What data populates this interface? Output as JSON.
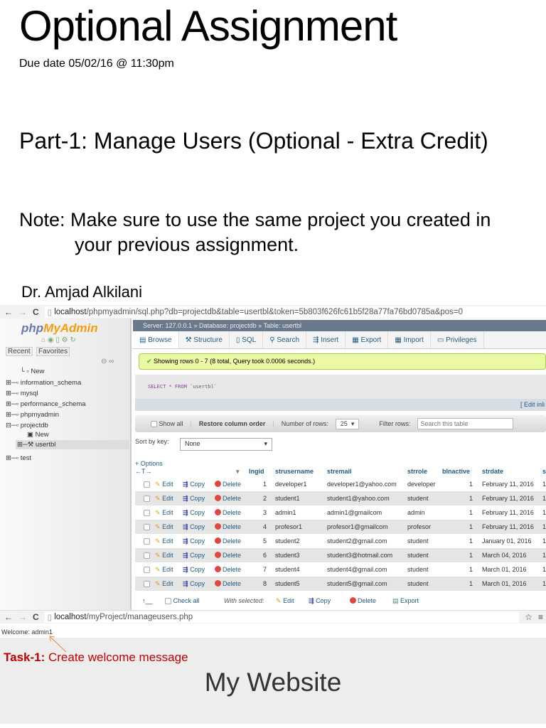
{
  "slide": {
    "title": "Optional Assignment",
    "due": "Due date 05/02/16 @ 11:30pm",
    "part": "Part-1: Manage Users (Optional - Extra Credit)",
    "note_label": "Note:",
    "note_line1": " Make sure to use the same project you created in",
    "note_line2": "your previous assignment.",
    "author": "Dr. Amjad Alkilani"
  },
  "browser1": {
    "url_host": "localhost",
    "url_rest": "/phpmyadmin/sql.php?db=projectdb&table=usertbl&token=5b803f626fc61b5f28a77fa76bd0785a&pos=0"
  },
  "pma": {
    "logo_a": "php",
    "logo_b": "MyAdmin",
    "recent": "Recent",
    "favorites": "Favorites",
    "tree": [
      "New",
      "information_schema",
      "mysql",
      "performance_schema",
      "phpmyadmin",
      "projectdb",
      "New",
      "usertbl",
      "test"
    ],
    "breadcrumb": "Server: 127.0.0.1 » Database: projectdb » Table: usertbl",
    "tabs": [
      "Browse",
      "Structure",
      "SQL",
      "Search",
      "Insert",
      "Export",
      "Import",
      "Privileges"
    ],
    "success": "Showing rows 0 - 7 (8 total, Query took 0.0006 seconds.)",
    "sql_kw": "SELECT * FROM",
    "sql_tbl": " `usertbl`",
    "edit_inline": "[ Edit inli",
    "show_all": "Show all",
    "restore": "Restore column order",
    "num_rows_label": "Number of rows:",
    "num_rows": "25",
    "filter_label": "Filter rows:",
    "filter_placeholder": "Search this table",
    "sort_label": "Sort by key:",
    "sort_value": "None",
    "options": "+ Options",
    "columns": [
      "lngid",
      "strusername",
      "stremail",
      "strrole",
      "blnactive",
      "strdate",
      "s"
    ],
    "actions": {
      "edit": "Edit",
      "copy": "Copy",
      "delete": "Delete"
    },
    "rows": [
      [
        "1",
        "developer1",
        "developer1@yahoo.com",
        "developer",
        "1",
        "February 11, 2016",
        "1"
      ],
      [
        "2",
        "student1",
        "student1@yahoo.com",
        "student",
        "1",
        "February 11, 2016",
        "1"
      ],
      [
        "3",
        "admin1",
        "admin1@gmailcom",
        "admin",
        "1",
        "February 11, 2016",
        "1"
      ],
      [
        "4",
        "profesor1",
        "profesor1@gmailcom",
        "profesor",
        "1",
        "February 11, 2016",
        "1"
      ],
      [
        "5",
        "student2",
        "student2@gmail.com",
        "student",
        "1",
        "January 01, 2016",
        "1"
      ],
      [
        "6",
        "student3",
        "student3@hotmail.com",
        "student",
        "1",
        "March 04, 2016",
        "1"
      ],
      [
        "7",
        "student4",
        "student4@gmail.com",
        "student",
        "1",
        "March 01, 2016",
        "1"
      ],
      [
        "8",
        "student5",
        "student5@gmail.com",
        "student",
        "1",
        "March 01, 2016",
        "1"
      ]
    ],
    "check_all": "Check all",
    "with_selected": "With selected:",
    "export": "Export"
  },
  "browser2": {
    "url_host": "localhost",
    "url_rest": "/myProject/manageusers.php"
  },
  "site": {
    "welcome": "Welcome: admin1",
    "task_label": "Task-1:",
    "task_text": " Create welcome message",
    "heading": "My Website"
  }
}
